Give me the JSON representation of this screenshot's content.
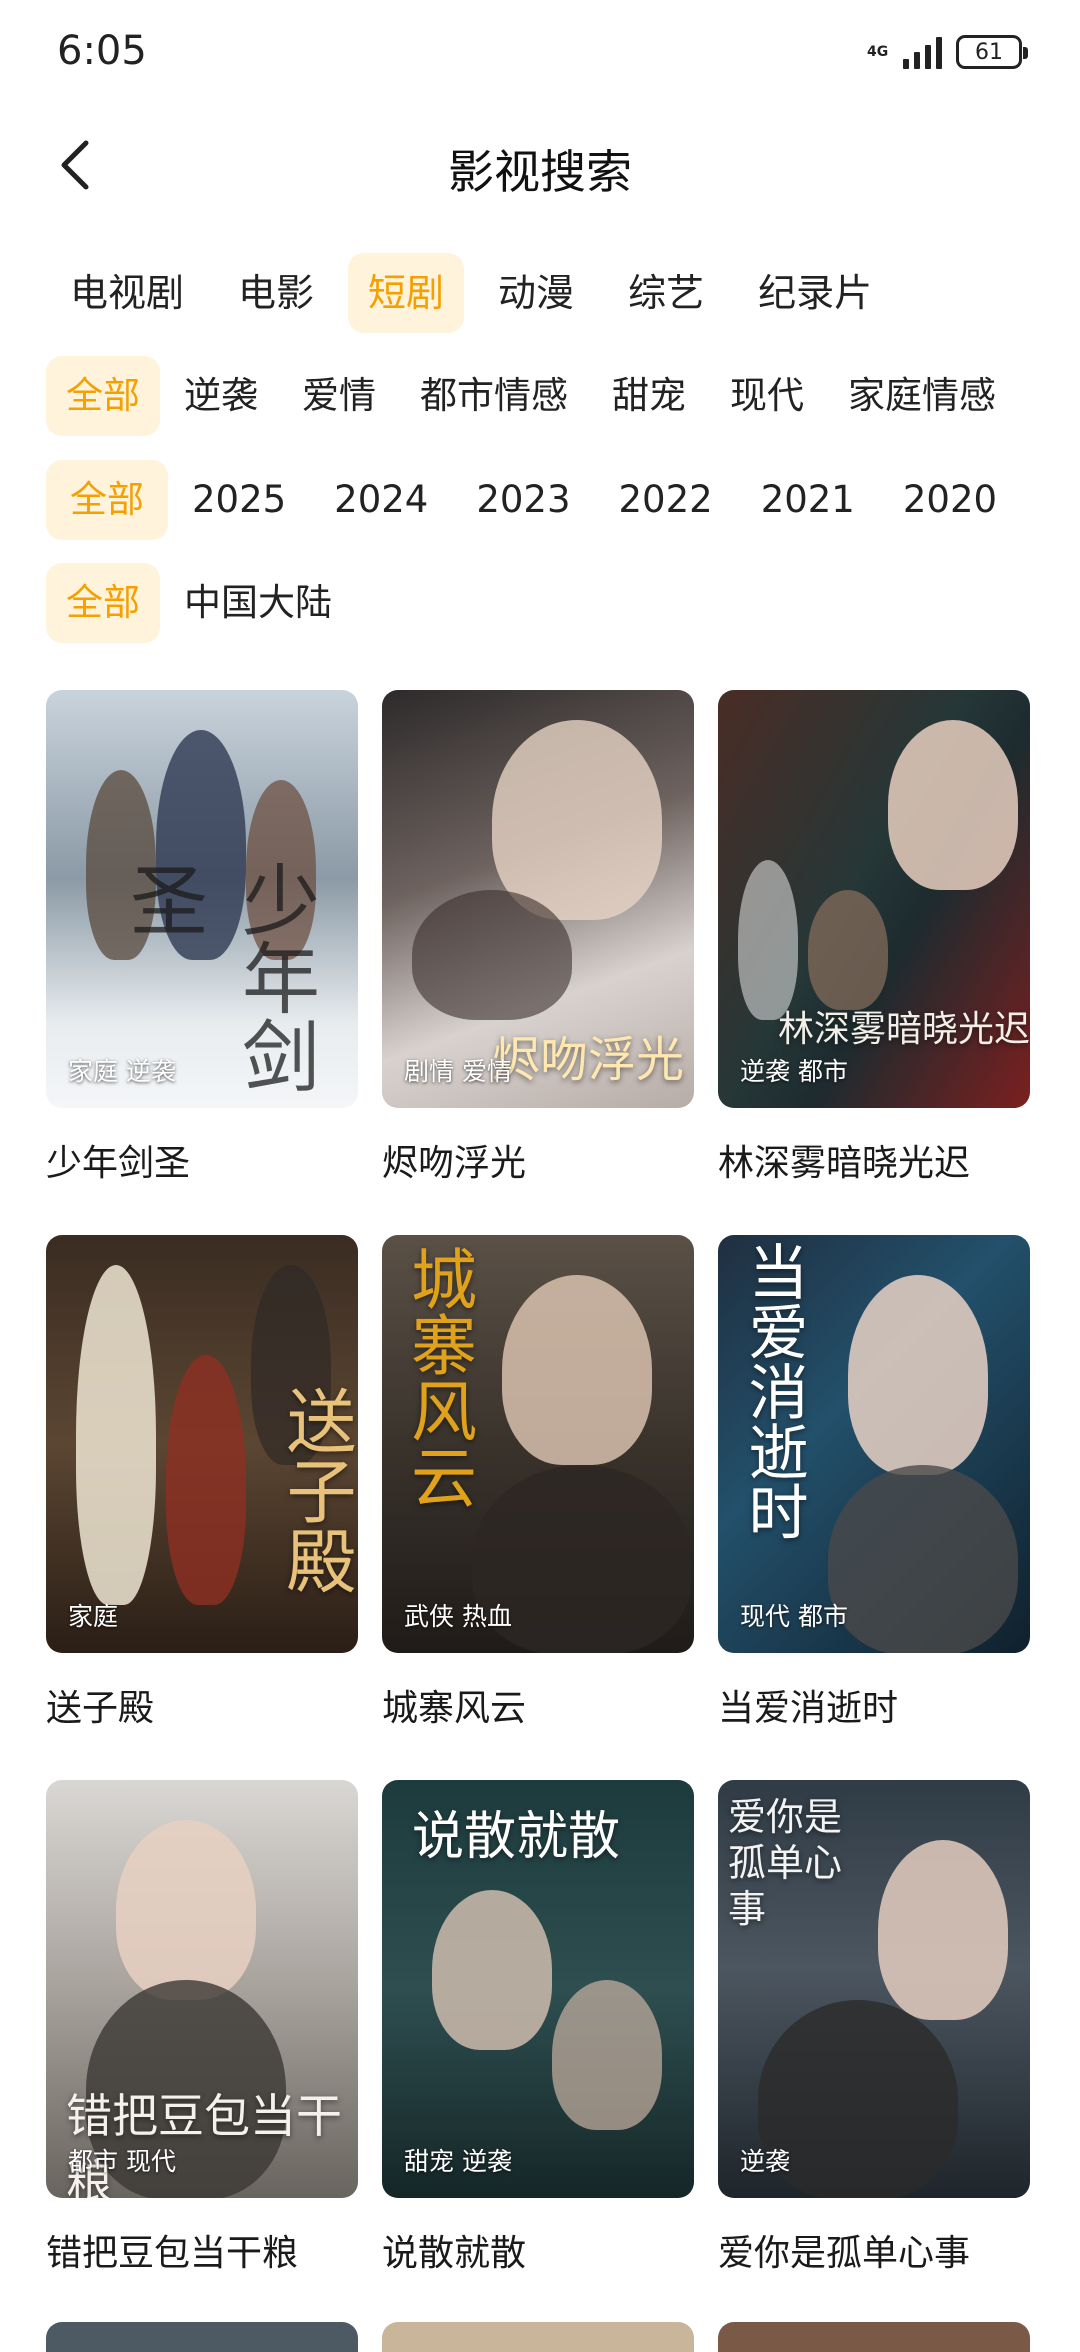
{
  "status": {
    "time": "6:05",
    "network": "4G",
    "battery": "61"
  },
  "header": {
    "title": "影视搜索"
  },
  "filters": {
    "categories": [
      "电视剧",
      "电影",
      "短剧",
      "动漫",
      "综艺",
      "纪录片"
    ],
    "genres": [
      "全部",
      "逆袭",
      "爱情",
      "都市情感",
      "甜宠",
      "现代",
      "家庭情感"
    ],
    "years": [
      "全部",
      "2025",
      "2024",
      "2023",
      "2022",
      "2021",
      "2020"
    ],
    "regions": [
      "全部",
      "中国大陆"
    ]
  },
  "items": [
    {
      "title": "少年剑圣",
      "tags": "家庭 逆袭",
      "art": "少年剑圣"
    },
    {
      "title": "烬吻浮光",
      "tags": "剧情 爱情",
      "art": "烬吻浮光"
    },
    {
      "title": "林深雾暗晓光迟",
      "tags": "逆袭 都市",
      "art": "林深雾暗晓光迟"
    },
    {
      "title": "送子殿",
      "tags": "家庭",
      "art": "送子殿"
    },
    {
      "title": "城寨风云",
      "tags": "武侠 热血",
      "art": "城寨风云"
    },
    {
      "title": "当爱消逝时",
      "tags": "现代 都市",
      "art": "当爱消逝时"
    },
    {
      "title": "错把豆包当干粮",
      "tags": "都市 现代",
      "art": "错把豆包当干粮"
    },
    {
      "title": "说散就散",
      "tags": "甜宠 逆袭",
      "art": "说散就散"
    },
    {
      "title": "爱你是孤单心事",
      "tags": "逆袭",
      "art": "爱你是孤单心事"
    }
  ]
}
